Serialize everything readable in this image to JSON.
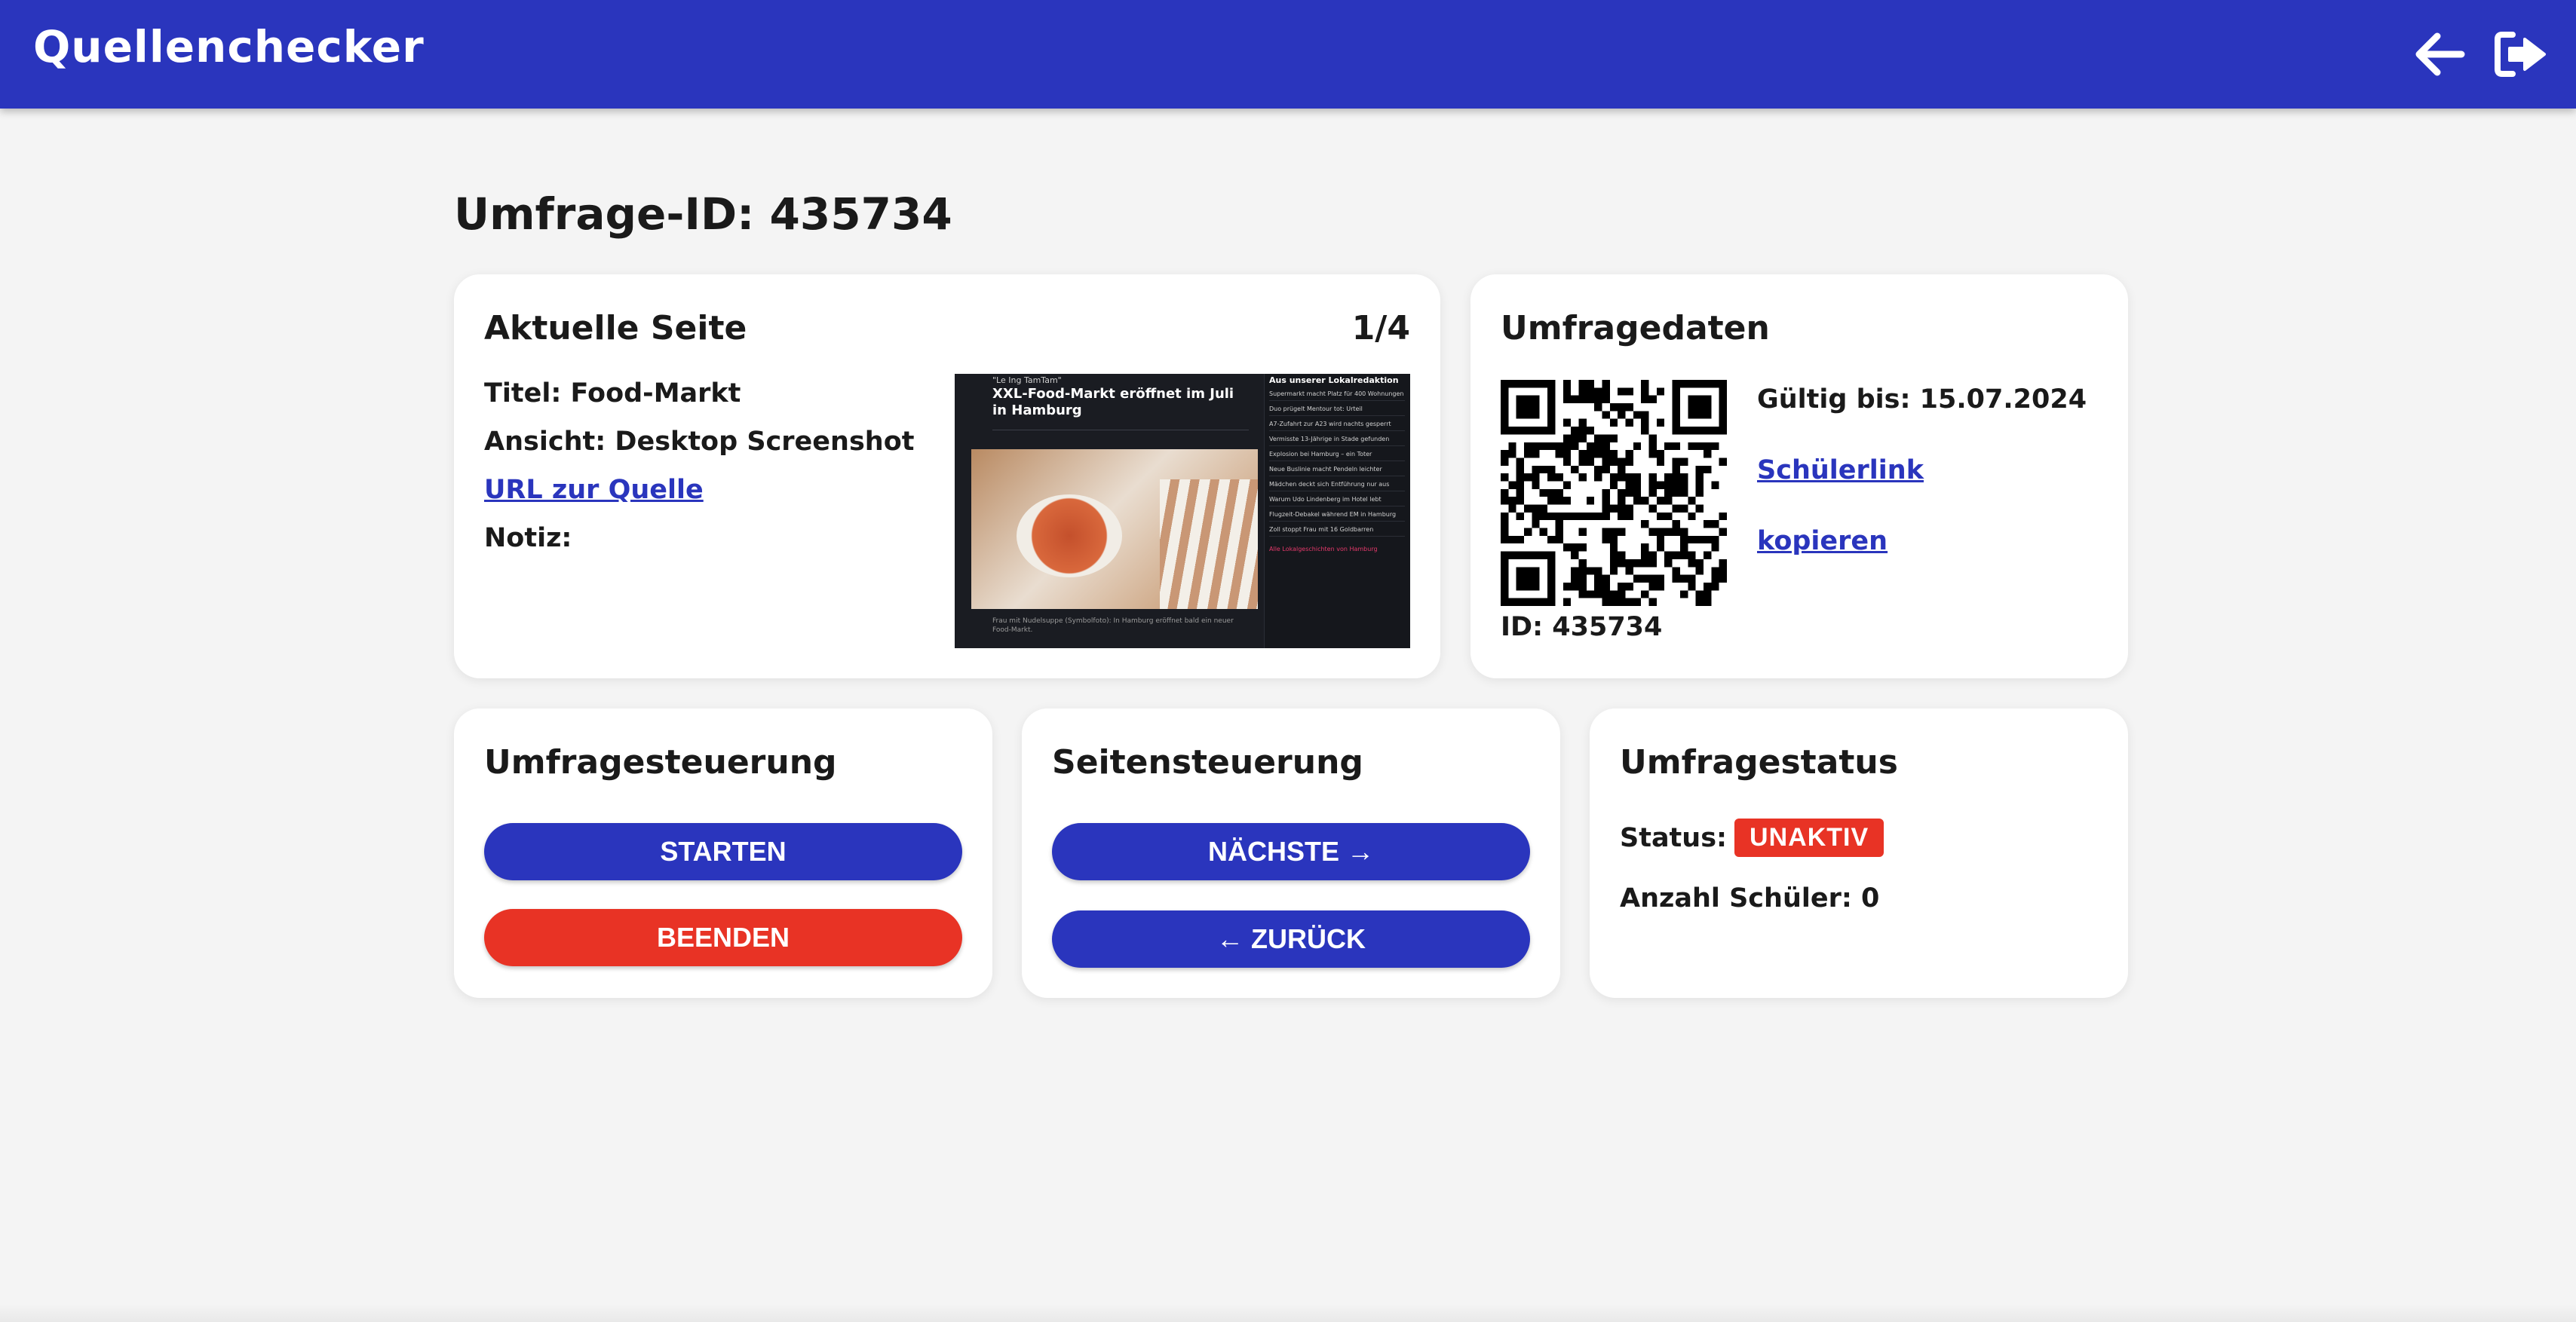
{
  "header": {
    "title": "Quellenchecker",
    "back_icon": "arrow-left-icon",
    "logout_icon": "logout-icon",
    "bg_color": "#2a35bd"
  },
  "page_heading": "Umfrage-ID: 435734",
  "current_page": {
    "title": "Aktuelle Seite",
    "counter": "1/4",
    "titel_label": "Titel:",
    "titel_value": "Food-Markt",
    "ansicht_label": "Ansicht:",
    "ansicht_value": "Desktop Screenshot",
    "url_link": "URL zur Quelle",
    "notiz_label": "Notiz:",
    "preview": {
      "kicker": "\"Le Ing TamTam\"",
      "headline": "XXL-Food-Markt eröffnet im Juli in Hamburg",
      "sidebar_title": "Aus unserer Lokalredaktion",
      "sidebar_items": [
        "Supermarkt macht Platz für 400 Wohnungen",
        "Duo prügelt Mentour tot: Urteil",
        "A7-Zufahrt zur A23 wird nachts gesperrt",
        "Vermisste 13-Jährige in Stade gefunden",
        "Explosion bei Hamburg – ein Toter",
        "Neue Buslinie macht Pendeln leichter",
        "Mädchen deckt sich Entführung nur aus",
        "Warum Udo Lindenberg im Hotel lebt",
        "Flugzeit-Debakel während EM in Hamburg",
        "Zoll stoppt Frau mit 16 Goldbarren"
      ],
      "sidebar_more": "Alle Lokalgeschichten von Hamburg",
      "caption": "Frau mit Nudelsuppe (Symbolfoto): In Hamburg eröffnet bald ein neuer Food-Markt."
    }
  },
  "survey_data": {
    "title": "Umfragedaten",
    "valid_until": "Gültig bis: 15.07.2024",
    "student_link": "Schülerlink",
    "copy_link": "kopieren",
    "id_text": "ID: 435734"
  },
  "survey_control": {
    "title": "Umfragesteuerung",
    "start_label": "STARTEN",
    "end_label": "BEENDEN"
  },
  "page_control": {
    "title": "Seitensteuerung",
    "next_label": "NÄCHSTE →",
    "back_label": "← ZURÜCK"
  },
  "survey_status": {
    "title": "Umfragestatus",
    "status_label": "Status:",
    "status_value": "UNAKTIV",
    "count_text": "Anzahl Schüler: 0",
    "status_color": "#e83325"
  }
}
